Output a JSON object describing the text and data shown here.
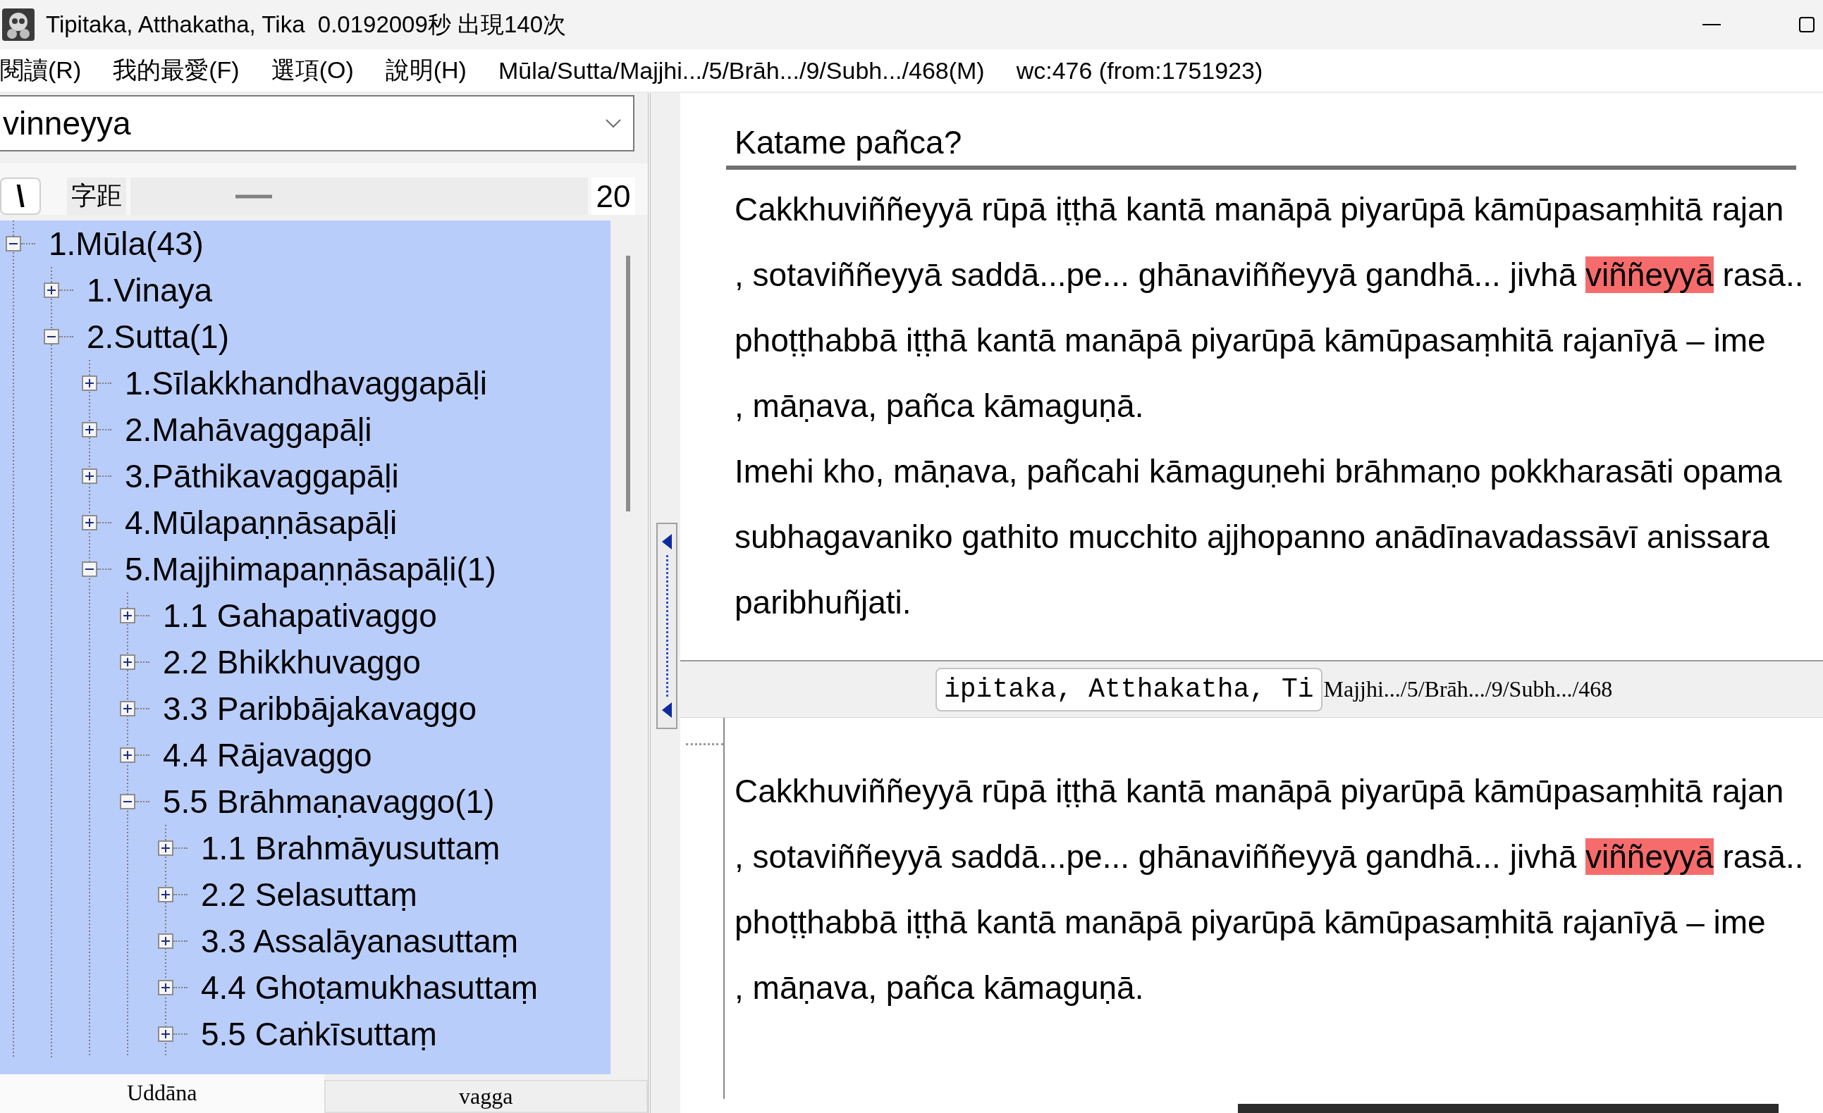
{
  "window": {
    "title": "Tipitaka, Atthakatha, Tika  0.0192009秒 出現140次"
  },
  "menu_bar": {
    "items": [
      "閱讀(R)",
      "我的最愛(F)",
      "選項(O)",
      "說明(H)"
    ],
    "path": "Mūla/Sutta/Majjhi.../5/Brāh.../9/Subh.../468(M)",
    "word_count": "wc:476 (from:1751923)"
  },
  "search": {
    "value": "vinneyya"
  },
  "spacing": {
    "button": "\\",
    "label": "字距",
    "level": 0.27,
    "value": "20"
  },
  "tree": [
    {
      "label": "1.Mūla(43)",
      "expanded": true,
      "children": [
        {
          "label": "1.Vinaya",
          "expanded": false
        },
        {
          "label": "2.Sutta(1)",
          "expanded": true,
          "children": [
            {
              "label": "1.Sīlakkhandhavaggapāḷi",
              "expanded": false
            },
            {
              "label": "2.Mahāvaggapāḷi",
              "expanded": false
            },
            {
              "label": "3.Pāthikavaggapāḷi",
              "expanded": false
            },
            {
              "label": "4.Mūlapaṇṇāsapāḷi",
              "expanded": false
            },
            {
              "label": "5.Majjhimapaṇṇāsapāḷi(1)",
              "expanded": true,
              "children": [
                {
                  "label": "1.1 Gahapativaggo",
                  "expanded": false
                },
                {
                  "label": "2.2 Bhikkhuvaggo",
                  "expanded": false
                },
                {
                  "label": "3.3 Paribbājakavaggo",
                  "expanded": false
                },
                {
                  "label": "4.4 Rājavaggo",
                  "expanded": false
                },
                {
                  "label": "5.5 Brāhmaṇavaggo(1)",
                  "expanded": true,
                  "children": [
                    {
                      "label": "1.1 Brahmāyusuttaṃ",
                      "expanded": false
                    },
                    {
                      "label": "2.2 Selasuttaṃ",
                      "expanded": false
                    },
                    {
                      "label": "3.3 Assalāyanasuttaṃ",
                      "expanded": false
                    },
                    {
                      "label": "4.4 Ghoṭamukhasuttaṃ",
                      "expanded": false
                    },
                    {
                      "label": "5.5 Caṅkīsuttaṃ",
                      "expanded": false
                    }
                  ]
                }
              ]
            }
          ]
        }
      ]
    }
  ],
  "bottom_tabs": [
    {
      "label": "Uddāna",
      "selected": true
    },
    {
      "label": "vagga",
      "selected": false
    }
  ],
  "reader": {
    "top_pane": {
      "heading": "Katame pañca?",
      "lines": [
        {
          "segments": [
            {
              "text": "Cakkhuviññeyyā rūpā iṭṭhā kantā manāpā piyarūpā kāmūpasaṃhitā rajan",
              "highlighted": false
            }
          ]
        },
        {
          "segments": [
            {
              "text": ", sotaviññeyyā saddā...pe... ghānaviññeyyā gandhā... jivhā ",
              "highlighted": false
            },
            {
              "text": "viññeyyā",
              "highlighted": true
            },
            {
              "text": " rasā..",
              "highlighted": false
            }
          ]
        },
        {
          "segments": [
            {
              "text": "phoṭṭhabbā iṭṭhā kantā manāpā piyarūpā kāmūpasaṃhitā rajanīyā – ime",
              "highlighted": false
            }
          ]
        },
        {
          "segments": [
            {
              "text": ", māṇava, pañca kāmaguṇā.",
              "highlighted": false
            }
          ]
        },
        {
          "segments": [
            {
              "text": "Imehi kho, māṇava, pañcahi kāmaguṇehi brāhmaṇo pokkharasāti opama",
              "highlighted": false
            }
          ]
        },
        {
          "segments": [
            {
              "text": "subhagavaniko gathito mucchito ajjhopanno anādīnavadassāvī anissara",
              "highlighted": false
            }
          ]
        },
        {
          "segments": [
            {
              "text": "paribhuñjati.",
              "highlighted": false
            }
          ]
        }
      ]
    },
    "title_field": {
      "value": "ipitaka, Atthakatha, Ti"
    },
    "path": "Majjhi.../5/Brāh.../9/Subh.../468",
    "bottom_pane": {
      "lines": [
        {
          "segments": [
            {
              "text": "Cakkhuviññeyyā rūpā iṭṭhā kantā manāpā piyarūpā kāmūpasaṃhitā rajan",
              "highlighted": false
            }
          ]
        },
        {
          "segments": [
            {
              "text": ", sotaviññeyyā saddā...pe... ghānaviññeyyā gandhā... jivhā ",
              "highlighted": false
            },
            {
              "text": "viññeyyā",
              "highlighted": true
            },
            {
              "text": " rasā..",
              "highlighted": false
            }
          ]
        },
        {
          "segments": [
            {
              "text": "phoṭṭhabbā iṭṭhā kantā manāpā piyarūpā kāmūpasaṃhitā rajanīyā – ime",
              "highlighted": false
            }
          ]
        },
        {
          "segments": [
            {
              "text": ", māṇava, pañca kāmaguṇā.",
              "highlighted": false
            }
          ]
        }
      ]
    }
  }
}
